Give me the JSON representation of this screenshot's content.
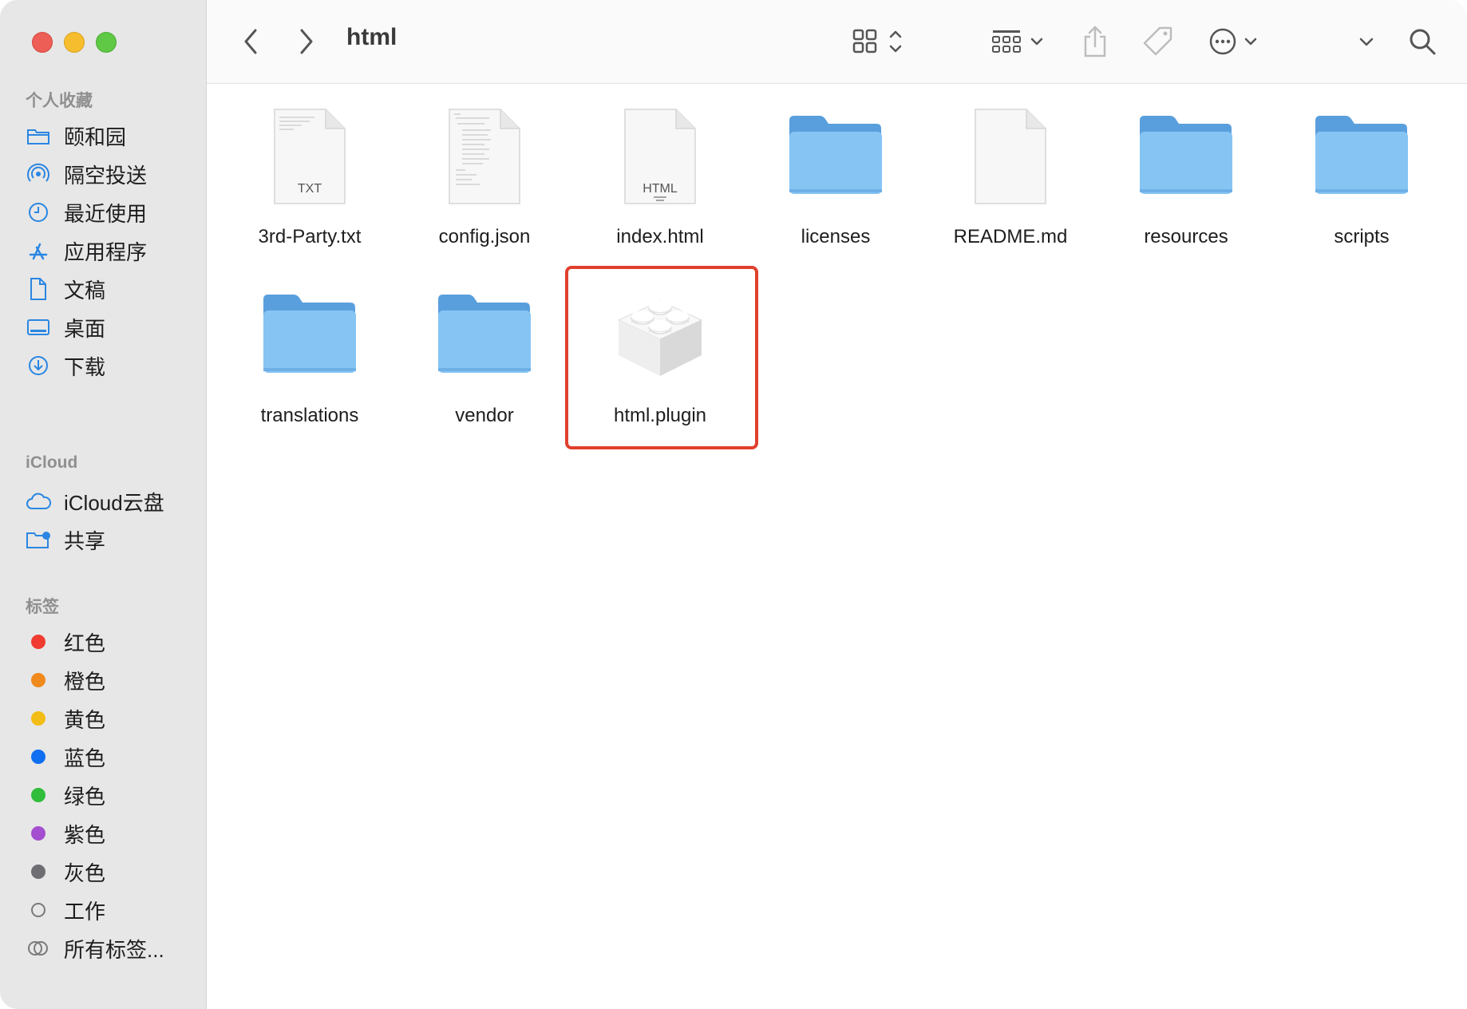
{
  "toolbar": {
    "title": "html",
    "back_icon": "chevron-left-icon",
    "forward_icon": "chevron-right-icon"
  },
  "sidebar": {
    "favorites_header": "个人收藏",
    "favorites": [
      {
        "label": "颐和园",
        "icon": "folder-icon"
      },
      {
        "label": "隔空投送",
        "icon": "airdrop-icon"
      },
      {
        "label": "最近使用",
        "icon": "clock-icon"
      },
      {
        "label": "应用程序",
        "icon": "applications-icon"
      },
      {
        "label": "文稿",
        "icon": "document-icon"
      },
      {
        "label": "桌面",
        "icon": "desktop-icon"
      },
      {
        "label": "下载",
        "icon": "download-icon"
      }
    ],
    "icloud_header": "iCloud",
    "icloud": [
      {
        "label": "iCloud云盘",
        "icon": "cloud-icon"
      },
      {
        "label": "共享",
        "icon": "shared-folder-icon"
      }
    ],
    "tags_header": "标签",
    "tags": [
      {
        "label": "红色",
        "color": "#ef3b30"
      },
      {
        "label": "橙色",
        "color": "#f08a1c"
      },
      {
        "label": "黄色",
        "color": "#f2bd16"
      },
      {
        "label": "蓝色",
        "color": "#0f6ff0"
      },
      {
        "label": "绿色",
        "color": "#2fbd3b"
      },
      {
        "label": "紫色",
        "color": "#a34fd0"
      },
      {
        "label": "灰色",
        "color": "#6d6d72"
      },
      {
        "label": "工作",
        "color": "none"
      },
      {
        "label": "所有标签...",
        "color": "all"
      }
    ]
  },
  "files": [
    {
      "name": "3rd-Party.txt",
      "kind": "txt",
      "badge": "TXT"
    },
    {
      "name": "config.json",
      "kind": "json",
      "badge": ""
    },
    {
      "name": "index.html",
      "kind": "html",
      "badge": "HTML"
    },
    {
      "name": "licenses",
      "kind": "folder",
      "badge": ""
    },
    {
      "name": "README.md",
      "kind": "blank",
      "badge": ""
    },
    {
      "name": "resources",
      "kind": "folder",
      "badge": ""
    },
    {
      "name": "scripts",
      "kind": "folder",
      "badge": ""
    },
    {
      "name": "translations",
      "kind": "folder",
      "badge": ""
    },
    {
      "name": "vendor",
      "kind": "folder",
      "badge": ""
    },
    {
      "name": "html.plugin",
      "kind": "plugin",
      "badge": ""
    }
  ],
  "colors": {
    "folder_body": "#86c4f4",
    "folder_tab": "#5a9fdd",
    "highlight": "#e0402e"
  }
}
